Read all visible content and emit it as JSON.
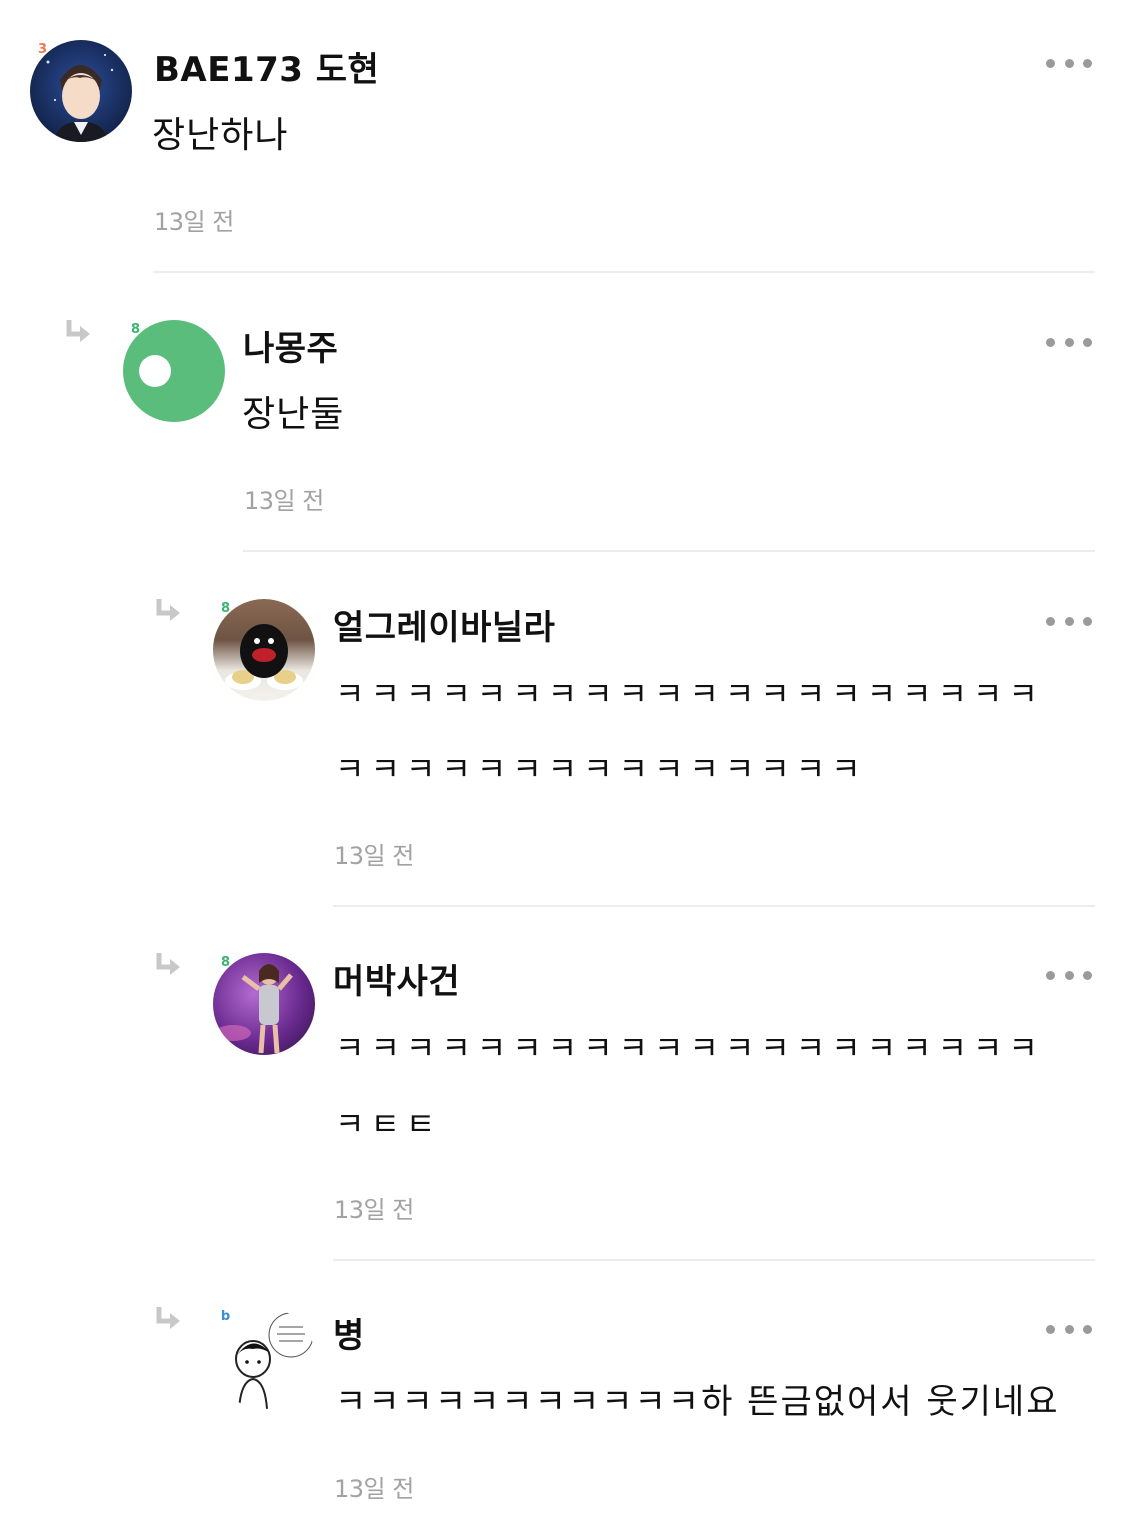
{
  "comments": [
    {
      "author": "BAE173 도현",
      "level": "3",
      "level_color": "#f07850",
      "text_lines": [
        "장난하나"
      ],
      "time": "13일 전",
      "avatar": "profile-photo"
    },
    {
      "author": "나몽주",
      "level": "8",
      "level_color": "#3cb371",
      "text_lines": [
        "장난둘"
      ],
      "time": "13일 전",
      "avatar": "default-green-avatar"
    },
    {
      "author": "얼그레이바닐라",
      "level": "8",
      "level_color": "#3cb371",
      "text_lines": [
        "ㅋㅋㅋㅋㅋㅋㅋㅋㅋㅋㅋㅋㅋㅋㅋㅋㅋㅋㅋㅋ",
        "ㅋㅋㅋㅋㅋㅋㅋㅋㅋㅋㅋㅋㅋㅋㅋ"
      ],
      "time": "13일 전",
      "avatar": "penguin-photo"
    },
    {
      "author": "머박사건",
      "level": "8",
      "level_color": "#3cb371",
      "text_lines": [
        "ㅋㅋㅋㅋㅋㅋㅋㅋㅋㅋㅋㅋㅋㅋㅋㅋㅋㅋㅋㅋ",
        "ㅋㅌㅌ"
      ],
      "time": "13일 전",
      "avatar": "performer-photo"
    },
    {
      "author": "병",
      "level": "b",
      "level_color": "#3a8fd8",
      "text_lines": [
        "ㅋㅋㅋㅋㅋㅋㅋㅋㅋㅋㅋ하 뜬금없어서 웃기네요"
      ],
      "time": "13일 전",
      "avatar": "cartoon-drawing"
    }
  ]
}
